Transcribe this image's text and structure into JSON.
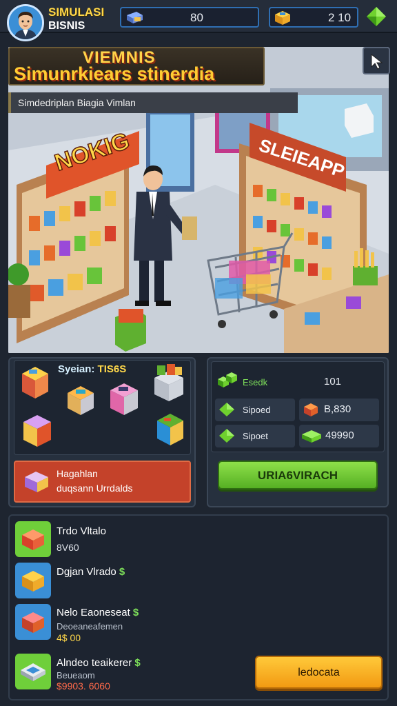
{
  "header": {
    "brand_line1": "SIMULASI",
    "brand_line2": "BISNIS",
    "money_value": "80",
    "stock_value": "2 10",
    "gem_icon": "green-gem-icon"
  },
  "scene": {
    "title_line1": "VIEMNIS",
    "title_line2": "Simunrkiears stinerdia",
    "subtitle": "Simdedriplan Biagia Vimlan",
    "left_sign": "NOKIG",
    "right_sign": "SLEIEAPP"
  },
  "system_panel": {
    "label_prefix": "Syeian:",
    "label_value": "TIS6S",
    "promo_line1": "Hagahlan",
    "promo_line2": "duqsann Urrdalds"
  },
  "stats_panel": {
    "row1_label": "Esedk",
    "row1_value": "101",
    "row2_label": "Sipoed",
    "row2_value": "B,830",
    "row3_label": "Sipoet",
    "row3_value": "49990",
    "action_label": "URIA6VIRACH"
  },
  "list": {
    "items": [
      {
        "title": "Trdo Vltalo",
        "value": "8V60",
        "tag": ""
      },
      {
        "title": "Dgjan Vlrado",
        "value": "",
        "tag": "$"
      },
      {
        "title": "Nelo Eaoneseat",
        "sub": "Deoeaneafemen",
        "value": "4$ 00",
        "tag": "$"
      },
      {
        "title": "Alndeo teaikerer",
        "sub": "Beueaom",
        "value": "$9903. 6060",
        "tag": "$"
      }
    ],
    "cta_label": "ledocata"
  },
  "colors": {
    "accent_yellow": "#ffd84a",
    "accent_green": "#76d13a",
    "accent_orange": "#c4422a",
    "accent_blue": "#2f6fb3"
  }
}
